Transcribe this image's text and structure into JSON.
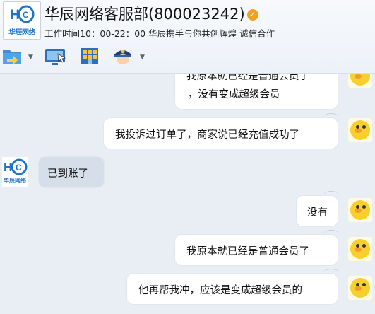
{
  "header": {
    "logo_text": "华辰网络",
    "title": "华辰网络客服部(800023242)",
    "subtitle": "工作时间10：00-22：00 华辰携手与你共创辉煌 诚信合作"
  },
  "toolbar": {
    "icons": [
      "file-transfer-icon",
      "remote-desktop-icon",
      "app-grid-icon",
      "police-icon"
    ]
  },
  "messages": [
    {
      "side": "right",
      "lines": [
        "我原本就已经是普通会员了",
        "，没有变成超级会员"
      ]
    },
    {
      "side": "right",
      "text": "我投诉过订单了，商家说已经充值成功了"
    },
    {
      "side": "left",
      "text": "已到账了"
    },
    {
      "side": "right",
      "text": "没有"
    },
    {
      "side": "right",
      "text": "我原本就已经是普通会员了"
    },
    {
      "side": "right",
      "text": "他再帮我冲，应该是变成超级会员的"
    }
  ],
  "colors": {
    "background": "#e9eef4",
    "bubble_out": "#ffffff",
    "bubble_in": "#d6dfe9",
    "brand_blue": "#1f73c9",
    "verified": "#f2a21e"
  }
}
